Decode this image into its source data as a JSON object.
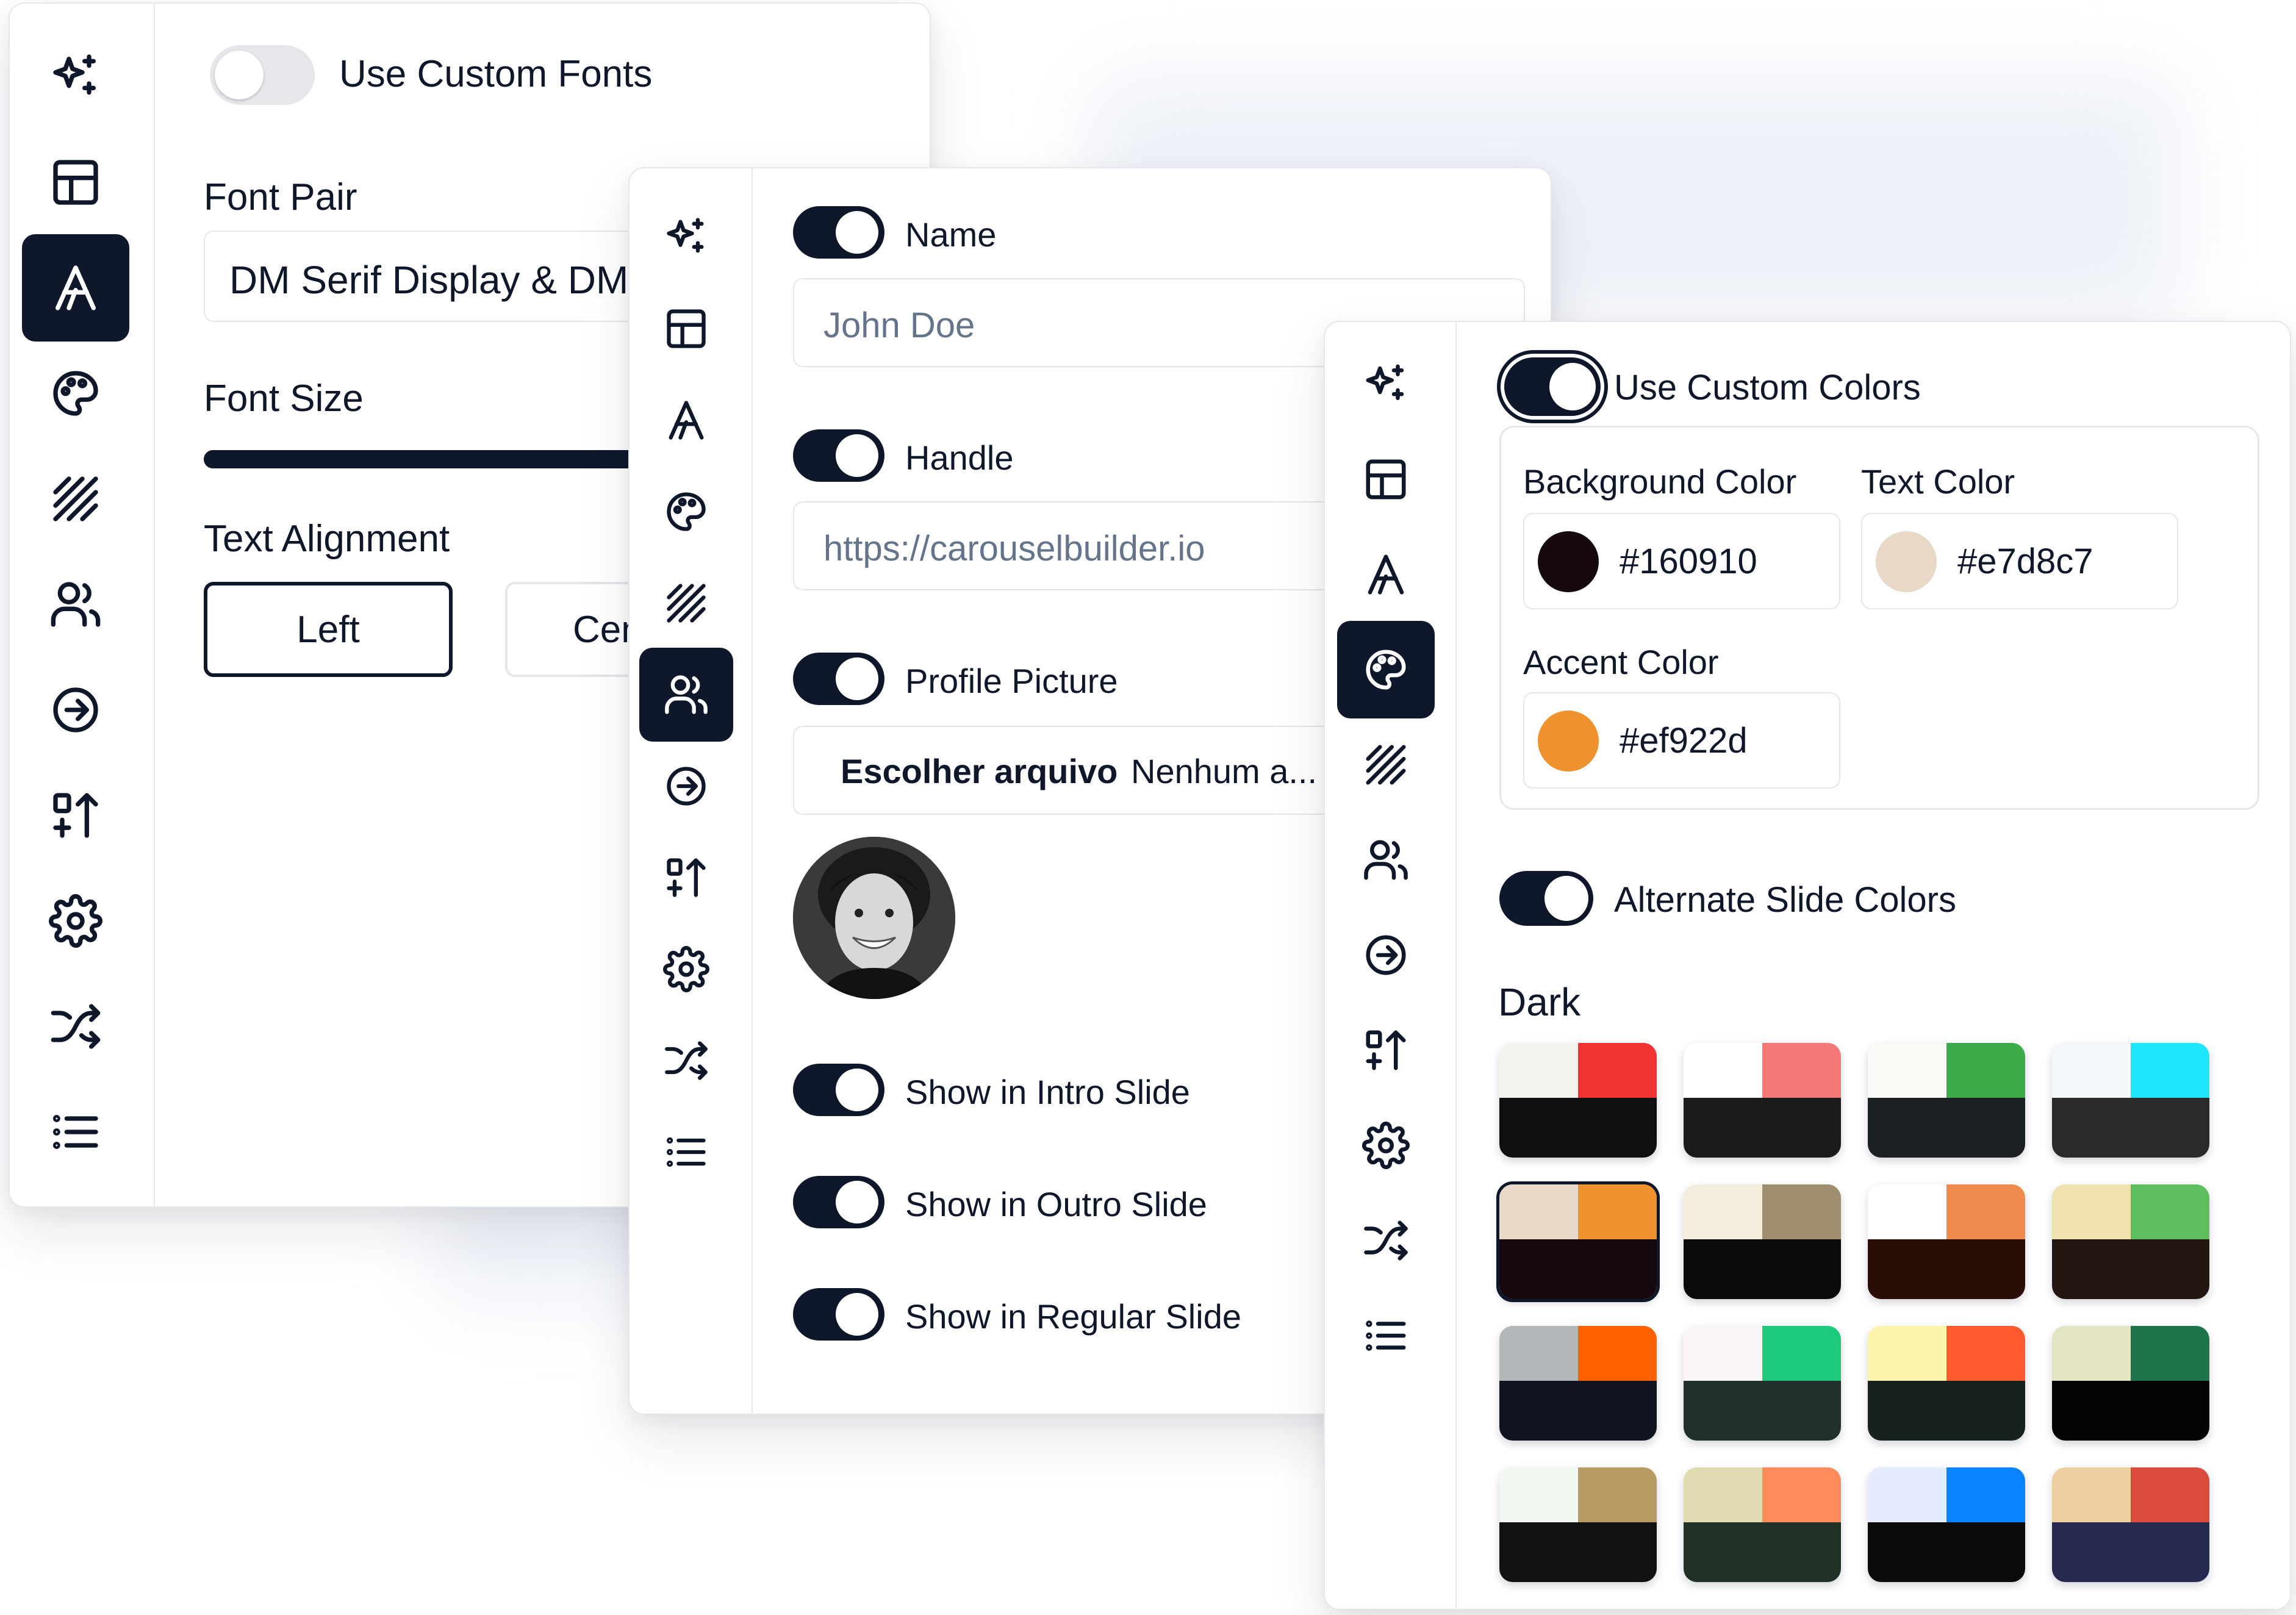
{
  "panel1": {
    "toggle_label": "Use Custom Fonts",
    "font_pair_label": "Font Pair",
    "font_pair_value": "DM Serif Display & DM Sans",
    "font_size_label": "Font Size",
    "font_size_fraction": 0.72,
    "text_alignment_label": "Text Alignment",
    "align_left": "Left",
    "align_center": "Center"
  },
  "panel2": {
    "name_label": "Name",
    "name_placeholder": "John Doe",
    "handle_label": "Handle",
    "handle_placeholder": "https://carouselbuilder.io",
    "profile_label": "Profile Picture",
    "file_button": "Escolher arquivo",
    "file_status": "Nenhum a...",
    "intro_label": "Show in Intro Slide",
    "outro_label": "Show in Outro Slide",
    "regular_label": "Show in Regular Slide"
  },
  "panel3": {
    "toggle_label": "Use Custom Colors",
    "bg_label": "Background Color",
    "bg_value": "#160910",
    "text_label": "Text Color",
    "text_value": "#e7d8c7",
    "accent_label": "Accent Color",
    "accent_value": "#ef922d",
    "alternate_label": "Alternate Slide Colors",
    "theme_label": "Dark",
    "palettes": [
      {
        "a": "#f4f4ee",
        "b": "#f03232",
        "c": "#0f0f0f"
      },
      {
        "a": "#ffffff",
        "b": "#f57878",
        "c": "#1a1a1a"
      },
      {
        "a": "#faf9f6",
        "b": "#3bab48",
        "c": "#1a2024"
      },
      {
        "a": "#f2f8fc",
        "b": "#1ee6ff",
        "c": "#2a2a2a"
      },
      {
        "a": "#e7d8c7",
        "b": "#ef922d",
        "c": "#160910",
        "selected": true
      },
      {
        "a": "#f3eedb",
        "b": "#9e8d6f",
        "c": "#0c0b0c"
      },
      {
        "a": "#ffffff",
        "b": "#ee8b4d",
        "c": "#2a0e06"
      },
      {
        "a": "#efe2ae",
        "b": "#5cbe5e",
        "c": "#221512"
      },
      {
        "a": "#b2b7ba",
        "b": "#ff6000",
        "c": "#0f1420"
      },
      {
        "a": "#faf3f8",
        "b": "#1dc97a",
        "c": "#21302a"
      },
      {
        "a": "#fdf4ad",
        "b": "#ff5a2e",
        "c": "#162120"
      },
      {
        "a": "#e2e4c4",
        "b": "#1b744a",
        "c": "#040404"
      },
      {
        "a": "#f1f8f1",
        "b": "#b79b60",
        "c": "#111312"
      },
      {
        "a": "#e0dab0",
        "b": "#ff8a5b",
        "c": "#1f3024"
      },
      {
        "a": "#e6ecff",
        "b": "#0b82ff",
        "c": "#0b0b0b"
      },
      {
        "a": "#eecfa0",
        "b": "#da4b3e",
        "c": "#27284f"
      }
    ]
  },
  "sidebar_icons": [
    "sparkles-icon",
    "layout-icon",
    "font-icon",
    "palette-icon",
    "pattern-icon",
    "users-icon",
    "arrow-right-circle-icon",
    "sort-icon",
    "gear-icon",
    "shuffle-icon",
    "list-icon"
  ],
  "colors": {
    "primary": "#0f172a",
    "border": "#e5e7eb",
    "placeholder": "#64748b"
  }
}
